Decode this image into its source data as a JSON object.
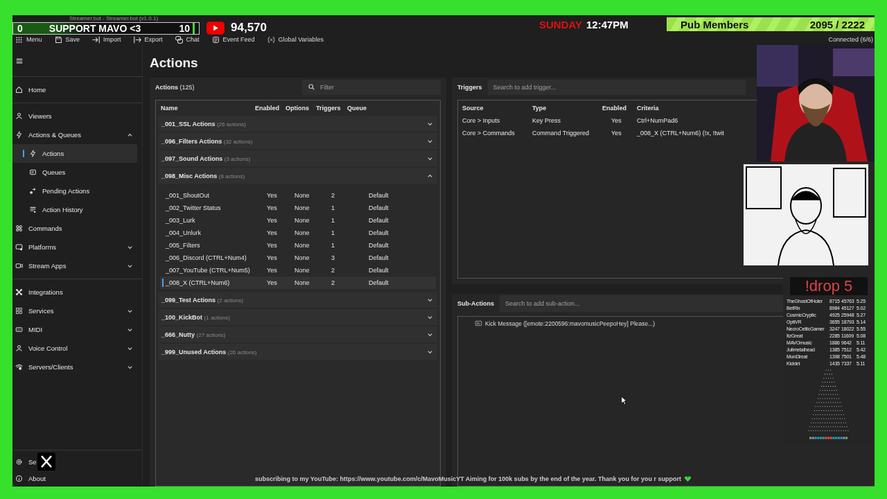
{
  "window": {
    "title": "Streamer.bot - Streamer.bot (v1.0.1)"
  },
  "toolbar": [
    {
      "label": "Menu"
    },
    {
      "label": "Save"
    },
    {
      "label": "Import"
    },
    {
      "label": "Export"
    },
    {
      "label": "Chat"
    },
    {
      "label": "Event Feed"
    },
    {
      "label": "Global Variables"
    }
  ],
  "connection": "Connected (6/6)",
  "sidebar": {
    "groups": [
      [
        {
          "label": "Home",
          "selected": false
        }
      ],
      [
        {
          "label": "Viewers",
          "selected": false
        },
        {
          "label": "Actions & Queues",
          "selected": false,
          "expanded": true,
          "children": [
            {
              "label": "Actions",
              "selected": true
            },
            {
              "label": "Queues",
              "selected": false
            },
            {
              "label": "Pending Actions",
              "selected": false
            },
            {
              "label": "Action History",
              "selected": false
            }
          ]
        },
        {
          "label": "Commands",
          "selected": false
        },
        {
          "label": "Platforms",
          "selected": false,
          "expanded": false
        },
        {
          "label": "Stream Apps",
          "selected": false,
          "expanded": false
        }
      ],
      [
        {
          "label": "Integrations",
          "selected": false
        },
        {
          "label": "Services",
          "selected": false,
          "expanded": false
        },
        {
          "label": "MIDI",
          "selected": false,
          "expanded": false
        },
        {
          "label": "Voice Control",
          "selected": false,
          "expanded": false
        },
        {
          "label": "Servers/Clients",
          "selected": false,
          "expanded": false
        }
      ]
    ],
    "footer": [
      {
        "label": "Se"
      },
      {
        "label": "About"
      }
    ]
  },
  "page_title": "Actions",
  "actions_panel": {
    "title": "Actions",
    "count": "(125)",
    "filter": {
      "placeholder": "Filter"
    },
    "columns": [
      "Name",
      "Enabled",
      "Options",
      "Triggers",
      "Queue"
    ],
    "groups": [
      {
        "name": "_001_SSL Actions",
        "count": "(26 actions)",
        "expanded": false
      },
      {
        "name": "_096_Filters Actions",
        "count": "(32 actions)",
        "expanded": false
      },
      {
        "name": "_097_Sound Actions",
        "count": "(3 actions)",
        "expanded": false
      },
      {
        "name": "_098_Misc Actions",
        "count": "(8 actions)",
        "expanded": true,
        "rows": [
          {
            "name": "_001_ShoutOut",
            "enabled": "Yes",
            "options": "None",
            "triggers": "2",
            "queue": "Default",
            "selected": false
          },
          {
            "name": "_002_Twitter Status",
            "enabled": "Yes",
            "options": "None",
            "triggers": "1",
            "queue": "Default",
            "selected": false
          },
          {
            "name": "_003_Lurk",
            "enabled": "Yes",
            "options": "None",
            "triggers": "1",
            "queue": "Default",
            "selected": false
          },
          {
            "name": "_004_Unlurk",
            "enabled": "Yes",
            "options": "None",
            "triggers": "1",
            "queue": "Default",
            "selected": false
          },
          {
            "name": "_005_Filters",
            "enabled": "Yes",
            "options": "None",
            "triggers": "1",
            "queue": "Default",
            "selected": false
          },
          {
            "name": "_006_Discord (CTRL+Num4)",
            "enabled": "Yes",
            "options": "None",
            "triggers": "3",
            "queue": "Default",
            "selected": false
          },
          {
            "name": "_007_YouTube (CTRL+Num5)",
            "enabled": "Yes",
            "options": "None",
            "triggers": "2",
            "queue": "Default",
            "selected": false
          },
          {
            "name": "_008_X (CTRL+Num6)",
            "enabled": "Yes",
            "options": "None",
            "triggers": "2",
            "queue": "Default",
            "selected": true
          }
        ]
      },
      {
        "name": "_099_Test Actions",
        "count": "(2 actions)",
        "expanded": false
      },
      {
        "name": "_100_KickBot",
        "count": "(1 actions)",
        "expanded": false
      },
      {
        "name": "_666_Nutty",
        "count": "(27 actions)",
        "expanded": false
      },
      {
        "name": "_999_Unused Actions",
        "count": "(26 actions)",
        "expanded": false
      }
    ]
  },
  "triggers": {
    "title": "Triggers",
    "search": {
      "placeholder": "Search to add trigger..."
    },
    "columns": [
      "Source",
      "Type",
      "Enabled",
      "Criteria"
    ],
    "rows": [
      {
        "source": "Core > Inputs",
        "type": "Key Press",
        "enabled": "Yes",
        "criteria": "Ctrl+NumPad6"
      },
      {
        "source": "Core > Commands",
        "type": "Command Triggered",
        "enabled": "Yes",
        "criteria": "_008_X (CTRL+Num6) (!x, !twit"
      }
    ]
  },
  "sub_actions": {
    "title": "Sub-Actions",
    "search": {
      "placeholder": "Search to add sub-action..."
    },
    "items": [
      {
        "label": "Kick Message ([emote:2200596:mavomusicPeepoHey] Please...)"
      }
    ]
  },
  "overlay": {
    "goal": {
      "current": "0",
      "label": "SUPPORT MAVO <3",
      "target": "10"
    },
    "youtube": {
      "subscribers": "94,570"
    },
    "clock": {
      "day": "SUNDAY",
      "time": "12:47PM"
    },
    "members": {
      "label": "Pub Members",
      "count": "2095 / 2222"
    },
    "drop": {
      "title": "!drop 5",
      "rows": [
        {
          "name": "TheGhostOfHoler",
          "a": "8715",
          "b": "45763",
          "c": "5.25"
        },
        {
          "name": "BetRix",
          "a": "8984",
          "b": "45127",
          "c": "5.02"
        },
        {
          "name": "CosmicCryptic",
          "a": "4925",
          "b": "25948",
          "c": "5.27"
        },
        {
          "name": "OptiVR",
          "a": "3655",
          "b": "18793",
          "c": "5.14"
        },
        {
          "name": "NecroCelticGamer",
          "a": "3247",
          "b": "18022",
          "c": "5.55"
        },
        {
          "name": "ItzGreat",
          "a": "2285",
          "b": "11609",
          "c": "5.08"
        },
        {
          "name": "MAVOmusic",
          "a": "1886",
          "b": "9642",
          "c": "5.11"
        },
        {
          "name": "Julimetalhead",
          "a": "1385",
          "b": "7512",
          "c": "5.42"
        },
        {
          "name": "Murd3reat",
          "a": "1398",
          "b": "7501",
          "c": "5.48"
        },
        {
          "name": "Kicklet",
          "a": "1435",
          "b": "7337",
          "c": "5.11"
        }
      ]
    },
    "ticker": "subscribing to my YouTube: https://www.youtube.com/c/MavoMusicYT Aiming for 100k subs by the end of the year. Thank you for you r support"
  }
}
